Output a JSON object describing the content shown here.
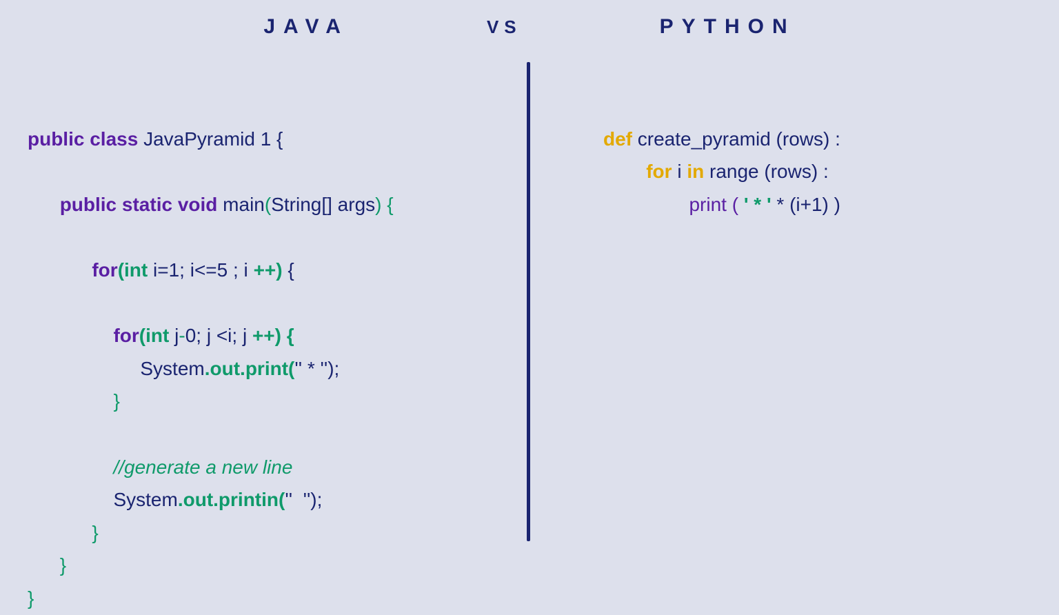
{
  "header": {
    "left": "JAVA",
    "mid": "VS",
    "right": "PYTHON"
  },
  "java": {
    "l1_kw": "public class ",
    "l1_txt": "JavaPyramid 1 {",
    "l2_kw": "public static void ",
    "l2_txt": "main",
    "l2_paren_o": "(",
    "l2_args": "String[] args",
    "l2_paren_c": ") {",
    "l3_for": "for",
    "l3_po": "(",
    "l3_int": "int ",
    "l3_cond": "i=1; i<=5 ; i ",
    "l3_pp": "++) ",
    "l3_brace": "{",
    "l4_for": "for",
    "l4_po": "(",
    "l4_int": "int ",
    "l4_j": "j",
    "l4_dash": "-",
    "l4_cond": "0; j <i; j ",
    "l4_pp": "++) {",
    "l5_sys": "System",
    "l5_out": ".out.print(",
    "l5_arg": "'' * '');",
    "l6_brace": "}",
    "l7_comment": "//generate a new line",
    "l8_sys": "System",
    "l8_out": ".out.printin(",
    "l8_arg": "''  '');",
    "l9_brace": "}",
    "l10_brace": "}",
    "l11_brace": "}"
  },
  "python": {
    "l1_def": "def ",
    "l1_name": "create_pyramid (rows) :",
    "l2_for": "for ",
    "l2_i": "i ",
    "l2_in": "in ",
    "l2_rest": "range (rows) :",
    "l3_print": "print ( ",
    "l3_star": "' * ' ",
    "l3_rest": "* (i+1) )"
  }
}
